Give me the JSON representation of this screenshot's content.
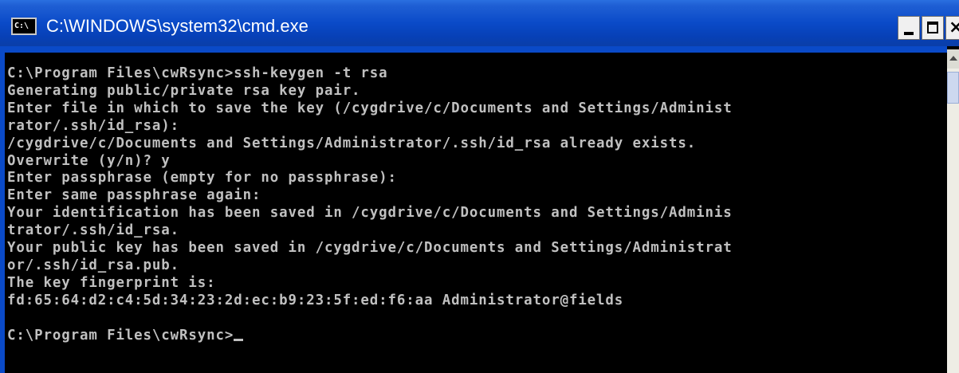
{
  "window": {
    "title": "C:\\WINDOWS\\system32\\cmd.exe",
    "icon_label": "C:\\",
    "buttons": {
      "minimize": "_",
      "maximize": "□",
      "close": "×"
    }
  },
  "console": {
    "lines": [
      "C:\\Program Files\\cwRsync>ssh-keygen -t rsa",
      "Generating public/private rsa key pair.",
      "Enter file in which to save the key (/cygdrive/c/Documents and Settings/Administ",
      "rator/.ssh/id_rsa):",
      "/cygdrive/c/Documents and Settings/Administrator/.ssh/id_rsa already exists.",
      "Overwrite (y/n)? y",
      "Enter passphrase (empty for no passphrase):",
      "Enter same passphrase again:",
      "Your identification has been saved in /cygdrive/c/Documents and Settings/Adminis",
      "trator/.ssh/id_rsa.",
      "Your public key has been saved in /cygdrive/c/Documents and Settings/Administrat",
      "or/.ssh/id_rsa.pub.",
      "The key fingerprint is:",
      "fd:65:64:d2:c4:5d:34:23:2d:ec:b9:23:5f:ed:f6:aa Administrator@fields",
      "",
      "C:\\Program Files\\cwRsync>"
    ]
  },
  "colors": {
    "titlebar": "#0a4ac8",
    "console_bg": "#000000",
    "console_text": "#c0c0c0"
  }
}
